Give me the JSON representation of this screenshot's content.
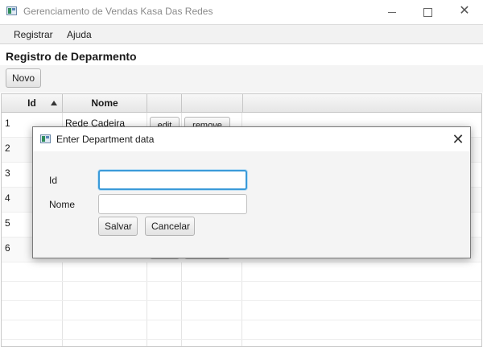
{
  "window": {
    "title": "Gerenciamento de Vendas Kasa Das Redes",
    "controls": {
      "minimize_icon": "minimize-icon",
      "maximize_icon": "maximize-icon",
      "close_glyph": "✕"
    }
  },
  "menubar": {
    "items": [
      "Registrar",
      "Ajuda"
    ]
  },
  "page": {
    "heading": "Registro de Deparmento"
  },
  "toolbar": {
    "novo_label": "Novo"
  },
  "table": {
    "headers": {
      "id": "Id",
      "nome": "Nome",
      "edit": "",
      "remove": ""
    },
    "sort": {
      "column": "Id",
      "direction": "ascending"
    },
    "rows": [
      {
        "id": "1",
        "nome": "Rede Cadeira",
        "edit": "edit",
        "remove": "remove"
      },
      {
        "id": "2",
        "nome": "",
        "edit": "",
        "remove": ""
      },
      {
        "id": "3",
        "nome": "",
        "edit": "",
        "remove": ""
      },
      {
        "id": "4",
        "nome": "",
        "edit": "",
        "remove": ""
      },
      {
        "id": "5",
        "nome": "",
        "edit": "",
        "remove": ""
      },
      {
        "id": "6",
        "nome": "",
        "edit": "",
        "remove": ""
      }
    ]
  },
  "dialog": {
    "title": "Enter Department data",
    "close_glyph": "✕",
    "fields": {
      "id": {
        "label": "Id",
        "value": "",
        "placeholder": ""
      },
      "nome": {
        "label": "Nome",
        "value": "",
        "placeholder": ""
      }
    },
    "buttons": {
      "salvar": "Salvar",
      "cancelar": "Cancelar"
    }
  },
  "colors": {
    "focus": "#3a9ad9",
    "title_text": "#8a8a8a",
    "button_border": "#b5b5b5"
  }
}
